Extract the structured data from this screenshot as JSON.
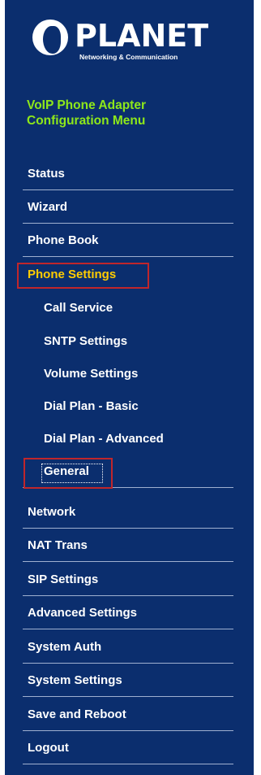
{
  "brand": {
    "name": "PLANET",
    "tagline": "Networking & Communication"
  },
  "menu_title": {
    "line1": "VoIP Phone Adapter",
    "line2": "Configuration Menu"
  },
  "menu": {
    "status": "Status",
    "wizard": "Wizard",
    "phone_book": "Phone Book",
    "phone_settings": "Phone Settings",
    "call_service": "Call Service",
    "sntp_settings": "SNTP Settings",
    "volume_settings": "Volume Settings",
    "dial_plan_basic": "Dial Plan - Basic",
    "dial_plan_advanced": "Dial Plan - Advanced",
    "general": "General",
    "network": "Network",
    "nat_trans": "NAT Trans",
    "sip_settings": "SIP Settings",
    "advanced_settings": "Advanced Settings",
    "system_auth": "System Auth",
    "system_settings": "System Settings",
    "save_and_reboot": "Save and Reboot",
    "logout": "Logout"
  },
  "colors": {
    "panel_background": "#0b2e6e",
    "title_color": "#8ee81a",
    "active_item_color": "#ffcc00",
    "highlight_border": "#c0262b"
  }
}
